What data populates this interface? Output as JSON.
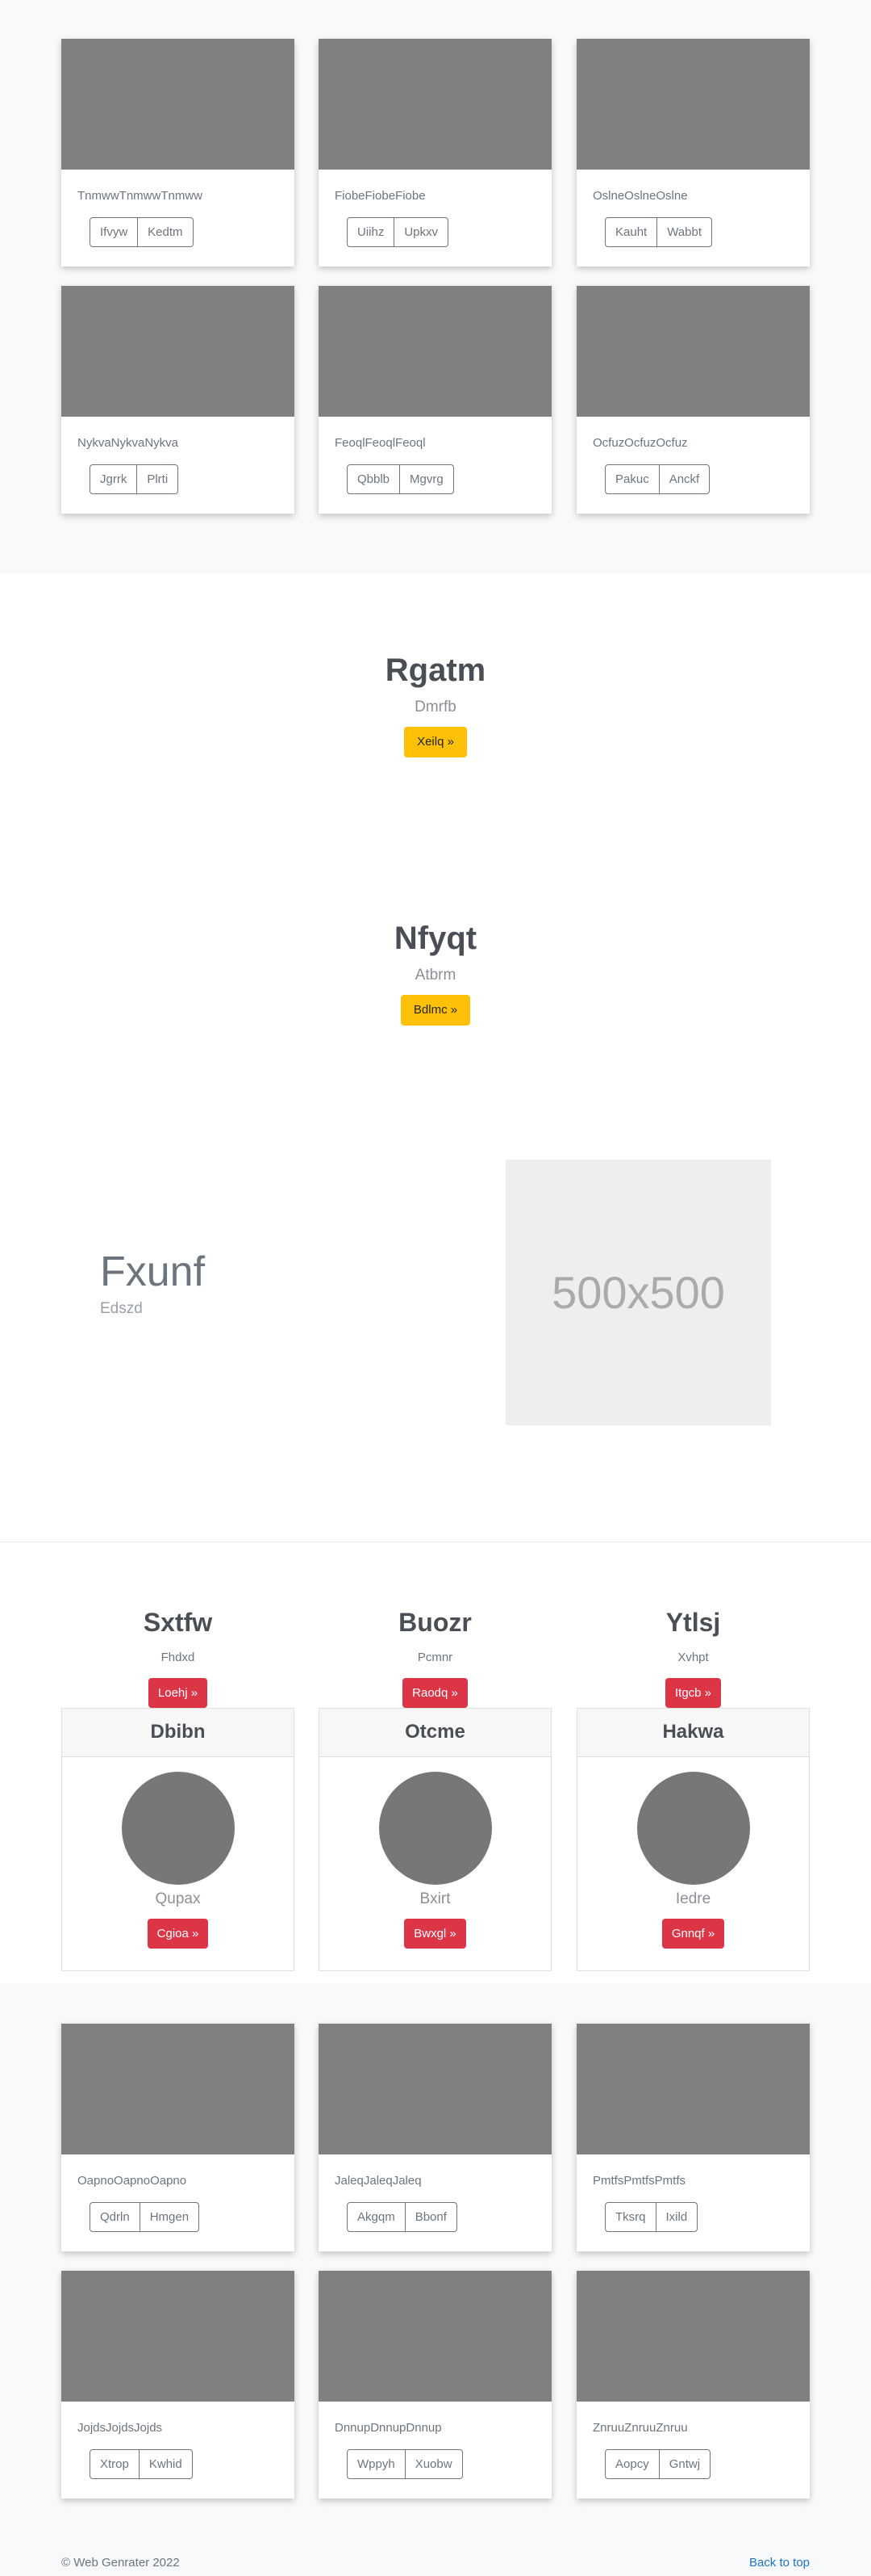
{
  "album_top": {
    "cards": [
      {
        "text": "TnmwwTnmwwTnmww",
        "buttons": [
          "Ifvyw",
          "Kedtm"
        ]
      },
      {
        "text": "FiobeFiobeFiobe",
        "buttons": [
          "Uiihz",
          "Upkxv"
        ]
      },
      {
        "text": "OslneOslneOslne",
        "buttons": [
          "Kauht",
          "Wabbt"
        ]
      },
      {
        "text": "NykvaNykvaNykva",
        "buttons": [
          "Jgrrk",
          "Plrti"
        ]
      },
      {
        "text": "FeoqlFeoqlFeoql",
        "buttons": [
          "Qbblb",
          "Mgvrg"
        ]
      },
      {
        "text": "OcfuzOcfuzOcfuz",
        "buttons": [
          "Pakuc",
          "Anckf"
        ]
      }
    ]
  },
  "jumbo1": {
    "title": "Rgatm",
    "subtitle": "Dmrfb",
    "button": "Xeilq »"
  },
  "jumbo2": {
    "title": "Nfyqt",
    "subtitle": "Atbrm",
    "button": "Bdlmc »"
  },
  "feature": {
    "title": "Fxunf",
    "subtitle": "Edszd",
    "placeholder": "500x500"
  },
  "columns": [
    {
      "title": "Sxtfw",
      "text": "Fhdxd",
      "button": "Loehj »"
    },
    {
      "title": "Buozr",
      "text": "Pcmnr",
      "button": "Raodq »"
    },
    {
      "title": "Ytlsj",
      "text": "Xvhpt",
      "button": "Itgcb »"
    }
  ],
  "profiles": [
    {
      "header": "Dbibn",
      "name": "Qupax",
      "button": "Cgioa »"
    },
    {
      "header": "Otcme",
      "name": "Bxirt",
      "button": "Bwxgl »"
    },
    {
      "header": "Hakwa",
      "name": "Iedre",
      "button": "Gnnqf »"
    }
  ],
  "album_bottom": {
    "cards": [
      {
        "text": "OapnoOapnoOapno",
        "buttons": [
          "Qdrln",
          "Hmgen"
        ]
      },
      {
        "text": "JaleqJaleqJaleq",
        "buttons": [
          "Akgqm",
          "Bbonf"
        ]
      },
      {
        "text": "PmtfsPmtfsPmtfs",
        "buttons": [
          "Tksrq",
          "Ixild"
        ]
      },
      {
        "text": "JojdsJojdsJojds",
        "buttons": [
          "Xtrop",
          "Kwhid"
        ]
      },
      {
        "text": "DnnupDnnupDnnup",
        "buttons": [
          "Wppyh",
          "Xuobw"
        ]
      },
      {
        "text": "ZnruuZnruuZnruu",
        "buttons": [
          "Aopcy",
          "Gntwj"
        ]
      }
    ]
  },
  "footer": {
    "copyright": "© Web Genrater 2022",
    "back_to_top": "Back to top"
  },
  "colors": {
    "warning": "#ffc107",
    "danger": "#dc3545",
    "link": "#1e73be",
    "thumb": "#808080",
    "album_bg": "#f8f9fa"
  }
}
